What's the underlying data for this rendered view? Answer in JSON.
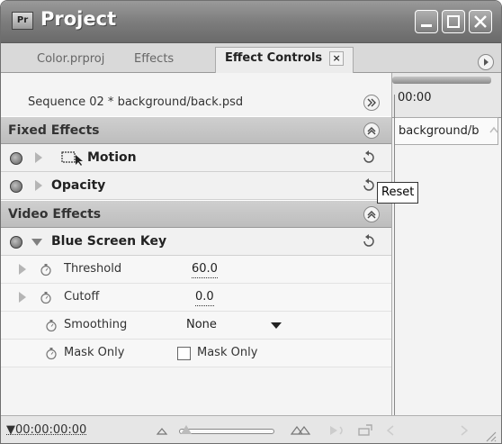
{
  "window": {
    "title": "Project"
  },
  "tabs": [
    {
      "label": "Color.prproj"
    },
    {
      "label": "Effects"
    },
    {
      "label": "Effect Controls",
      "close": "×"
    }
  ],
  "sequence_label": "Sequence 02 * background/back.psd",
  "sections": {
    "fixed": "Fixed Effects",
    "video": "Video Effects"
  },
  "effects": {
    "motion": "Motion",
    "opacity": "Opacity",
    "blue_screen_key": "Blue Screen Key"
  },
  "params": {
    "threshold": {
      "label": "Threshold",
      "value": "60.0"
    },
    "cutoff": {
      "label": "Cutoff",
      "value": "0.0"
    },
    "smoothing": {
      "label": "Smoothing",
      "value": "None"
    },
    "mask_only": {
      "label": "Mask Only",
      "checkbox_label": "Mask Only"
    }
  },
  "timeline": {
    "timecode": "00:00",
    "clip_name": "background/b"
  },
  "tooltip": "Reset",
  "footer": {
    "timecode": "00:00:00:00"
  },
  "icons": {
    "app": "premiere-window-icon",
    "reset": "reset-icon",
    "toggle": "fx-toggle-icon",
    "stopwatch": "stopwatch-icon"
  }
}
